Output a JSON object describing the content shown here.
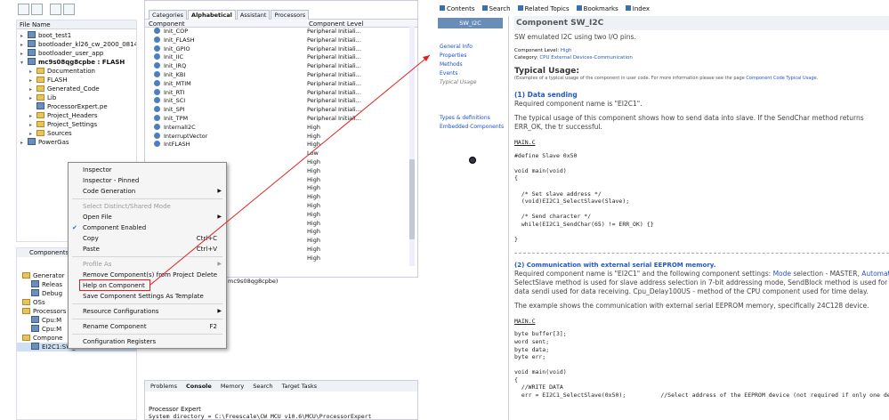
{
  "component_inspector": {
    "columns": [
      "Component",
      "Component Level"
    ],
    "tabs": [
      "Categories",
      "Alphabetical",
      "Assistant",
      "Processors"
    ],
    "rows": [
      [
        "Init_COP",
        "Peripheral Initiali..."
      ],
      [
        "Init_FLASH",
        "Peripheral Initiali..."
      ],
      [
        "Init_GPIO",
        "Peripheral Initiali..."
      ],
      [
        "Init_IIC",
        "Peripheral Initiali..."
      ],
      [
        "Init_IRQ",
        "Peripheral Initiali..."
      ],
      [
        "Init_KBI",
        "Peripheral Initiali..."
      ],
      [
        "Init_MTIM",
        "Peripheral Initiali..."
      ],
      [
        "Init_RTI",
        "Peripheral Initiali..."
      ],
      [
        "Init_SCI",
        "Peripheral Initiali..."
      ],
      [
        "Init_SPI",
        "Peripheral Initiali..."
      ],
      [
        "Init_TPM",
        "Peripheral Initiali..."
      ],
      [
        "InternalI2C",
        "High"
      ],
      [
        "InterruptVector",
        "High"
      ],
      [
        "IntFLASH",
        "High"
      ],
      [
        "",
        "Low"
      ],
      [
        "",
        "High"
      ],
      [
        "",
        "High"
      ],
      [
        "",
        "High"
      ],
      [
        "",
        "High"
      ],
      [
        "",
        "High"
      ],
      [
        "",
        "High"
      ],
      [
        "",
        "High"
      ],
      [
        "",
        "High"
      ],
      [
        "",
        "High"
      ],
      [
        "",
        "High"
      ],
      [
        "",
        "High"
      ],
      [
        "",
        "High"
      ]
    ]
  },
  "project_tree": {
    "header": "File Name",
    "items": [
      {
        "label": "boot_test1",
        "level": 0,
        "type": "project"
      },
      {
        "label": "bootloader_kl26_cw_2000_0814",
        "level": 0,
        "type": "project"
      },
      {
        "label": "bootloader_user_app",
        "level": 0,
        "type": "project"
      },
      {
        "label": "mc9s08qg8cpbe : FLASH",
        "level": 0,
        "type": "project",
        "bold": true,
        "expanded": true
      },
      {
        "label": "Documentation",
        "level": 1,
        "type": "folder"
      },
      {
        "label": "FLASH",
        "level": 1,
        "type": "folder"
      },
      {
        "label": "Generated_Code",
        "level": 1,
        "type": "folder"
      },
      {
        "label": "Lib",
        "level": 1,
        "type": "folder"
      },
      {
        "label": "ProcessorExpert.pe",
        "level": 1,
        "type": "file"
      },
      {
        "label": "Project_Headers",
        "level": 1,
        "type": "folder"
      },
      {
        "label": "Project_Settings",
        "level": 1,
        "type": "folder"
      },
      {
        "label": "Sources",
        "level": 1,
        "type": "folder"
      },
      {
        "label": "PowerGas",
        "level": 0,
        "type": "project"
      }
    ]
  },
  "components_panel": {
    "title": "Components -",
    "items": [
      "Generator",
      "Releas",
      "Debug",
      "OSs",
      "Processors",
      "Cpu:M",
      "Cpu:M",
      "Compone",
      "EI2C1:SW_I2C"
    ]
  },
  "context_menu": {
    "items": [
      {
        "label": "Inspector",
        "shortcut": "",
        "submenu": false,
        "disabled": false
      },
      {
        "label": "Inspector - Pinned",
        "shortcut": "",
        "submenu": false,
        "disabled": false
      },
      {
        "label": "Code Generation",
        "shortcut": "",
        "submenu": true,
        "disabled": false
      },
      {
        "sep": true
      },
      {
        "label": "Select Distinct/Shared Mode",
        "shortcut": "",
        "submenu": false,
        "disabled": true
      },
      {
        "label": "Open File",
        "shortcut": "",
        "submenu": true,
        "disabled": false
      },
      {
        "label": "Component Enabled",
        "shortcut": "",
        "submenu": false,
        "disabled": false,
        "checked": true
      },
      {
        "label": "Copy",
        "shortcut": "Ctrl+C",
        "submenu": false,
        "disabled": false
      },
      {
        "label": "Paste",
        "shortcut": "Ctrl+V",
        "submenu": false,
        "disabled": false
      },
      {
        "sep": true
      },
      {
        "label": "Profile As",
        "shortcut": "",
        "submenu": true,
        "disabled": true
      },
      {
        "label": "Remove Component(s) from Project",
        "shortcut": "Delete",
        "submenu": false,
        "disabled": false
      },
      {
        "label": "Help on Component",
        "shortcut": "",
        "submenu": false,
        "disabled": false,
        "highlighted": true
      },
      {
        "label": "Save Component Settings As Template",
        "shortcut": "",
        "submenu": false,
        "disabled": false
      },
      {
        "sep": true
      },
      {
        "label": "Resource Configurations",
        "shortcut": "",
        "submenu": true,
        "disabled": false
      },
      {
        "sep": true
      },
      {
        "label": "Rename Component",
        "shortcut": "F2",
        "submenu": false,
        "disabled": false
      },
      {
        "sep": true
      },
      {
        "label": "Configuration Registers",
        "shortcut": "",
        "submenu": false,
        "disabled": false
      }
    ]
  },
  "menu_tail_text": "mc9s08qg8cpbe)",
  "console": {
    "tabs": [
      "Problems",
      "Console",
      "Memory",
      "Search",
      "Target Tasks"
    ],
    "title": "Processor Expert",
    "line": "System directory = C:\\Freescale\\CW MCU v10.6\\MCU\\ProcessorExpert"
  },
  "help": {
    "toolbar": [
      "Contents",
      "Search",
      "Related Topics",
      "Bookmarks",
      "Index"
    ],
    "nav_header": "SW_I2C",
    "nav": [
      "General Info",
      "Properties",
      "Methods",
      "Events",
      "Typical Usage",
      "Types & definitions",
      "Embedded Components"
    ],
    "title": "Component SW_I2C",
    "subtitle": "SW emulated I2C using two I/O pins.",
    "level_label": "Component Level:",
    "level_value": "High",
    "category_label": "Category:",
    "category_value": "CPU External Devices-Communication",
    "typical_usage_heading": "Typical Usage:",
    "typical_usage_note": "(Examples of a typical usage of the component in user code. For more information please see the page",
    "typical_usage_link": "Component Code Typical Usage.",
    "sec1_heading": "(1) Data sending",
    "sec1_p1": "Required component name is \"EI2C1\".",
    "sec1_p2": "The typical usage of this component shows how to send data into slave. If the SendChar method returns ERR_OK, the tr successful.",
    "file1": "MAIN.C",
    "code1": "#define Slave 0x50\n\nvoid main(void)\n{\n\n  /* Set slave address */\n  (void)EI2C1_SelectSlave(Slave);\n\n  /* Send character */\n  while(EI2C1_SendChar(65) != ERR_OK) {}\n\n}",
    "sec2_heading": "(2) Communication with external serial EEPROM memory.",
    "sec2_p1": "Required component name is \"EI2C1\" and the following component settings:",
    "sec2_p1_links": [
      "Mode",
      "selection - MASTER,",
      "Automatic Stop cond"
    ],
    "sec2_p2": "SelectSlave method is used for slave address selection in 7-bit addressing mode, SendBlock method is used for data sendi used for data receiving. Cpu_Delay100US - method of the CPU component used for time delay.",
    "sec2_p3": "The example shows the communication with external serial EEPROM memory, specifically 24C128 device.",
    "file2": "MAIN.C",
    "code2": "byte buffer[3];\nword sent;\nbyte data;\nbyte err;\n\nvoid main(void)\n{\n  //WRITE DATA\n  err = EI2C1_SelectSlave(0x50);          //Select address of the EEPROM device (not required if only one de"
  }
}
